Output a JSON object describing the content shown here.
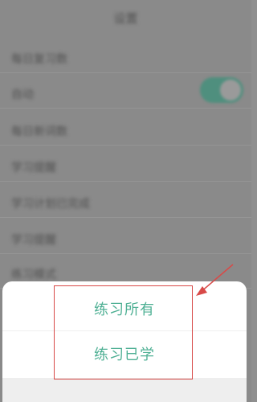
{
  "page": {
    "title": "设置"
  },
  "background": {
    "rows": [
      {
        "label": "每日复习数",
        "value": ""
      },
      {
        "label": "自动",
        "value": ""
      },
      {
        "label": "每日新词数",
        "value": ""
      },
      {
        "label": "学习提醒",
        "value": ""
      },
      {
        "label": "学习计划已完成",
        "value": ""
      },
      {
        "label": "学习提醒",
        "value": ""
      },
      {
        "label": "练习模式",
        "value": ""
      }
    ]
  },
  "sheet": {
    "option_all": "练习所有",
    "option_learned": "练习已学"
  },
  "colors": {
    "accent": "#4fb094",
    "annotation": "#d84a48"
  }
}
